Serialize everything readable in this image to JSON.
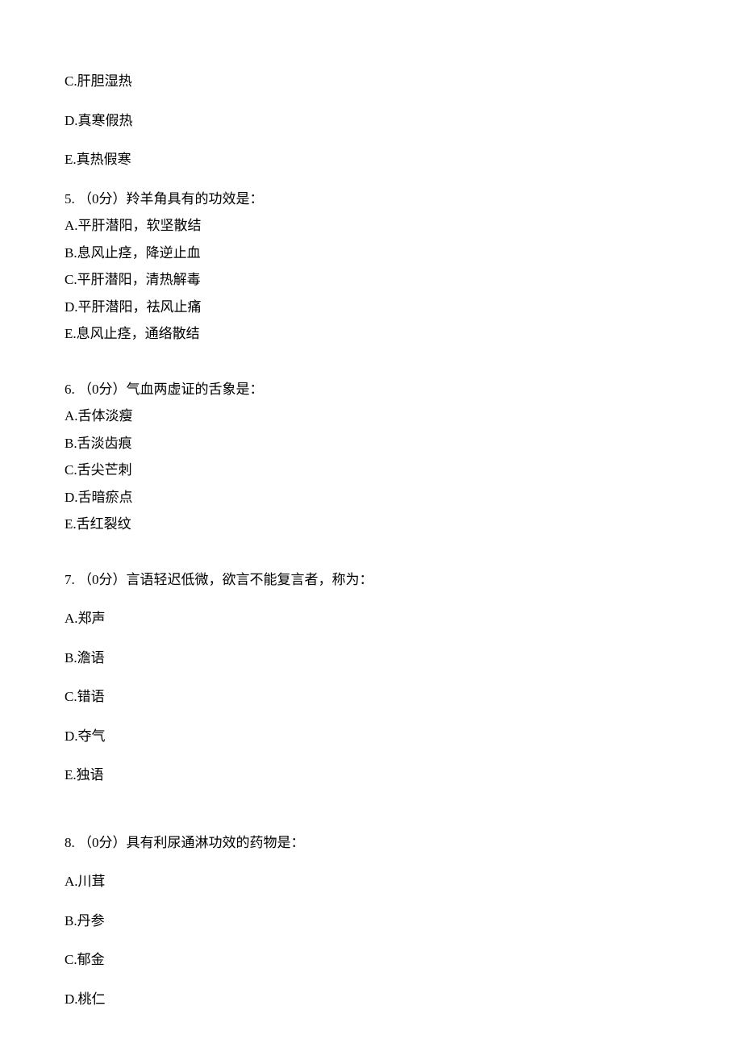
{
  "remnant_q4": {
    "options": {
      "C": "C.肝胆湿热",
      "D": "D.真寒假热",
      "E": "E.真热假寒"
    }
  },
  "q5": {
    "stem": "5. （0分）羚羊角具有的功效是：",
    "options": {
      "A": "A.平肝潜阳，软坚散结",
      "B": "B.息风止痉，降逆止血",
      "C": "C.平肝潜阳，清热解毒",
      "D": "D.平肝潜阳，祛风止痛",
      "E": "E.息风止痉，通络散结"
    }
  },
  "q6": {
    "stem": "6. （0分）气血两虚证的舌象是：",
    "options": {
      "A": "A.舌体淡瘦",
      "B": "B.舌淡齿痕",
      "C": "C.舌尖芒刺",
      "D": "D.舌暗瘀点",
      "E": "E.舌红裂纹"
    }
  },
  "q7": {
    "stem": "7. （0分）言语轻迟低微，欲言不能复言者，称为：",
    "options": {
      "A": "A.郑声",
      "B": "B.澹语",
      "C": "C.错语",
      "D": "D.夺气",
      "E": "E.独语"
    }
  },
  "q8": {
    "stem": "8. （0分）具有利尿通淋功效的药物是：",
    "options": {
      "A": "A.川茸",
      "B": "B.丹参",
      "C": "C.郁金",
      "D": "D.桃仁"
    }
  }
}
